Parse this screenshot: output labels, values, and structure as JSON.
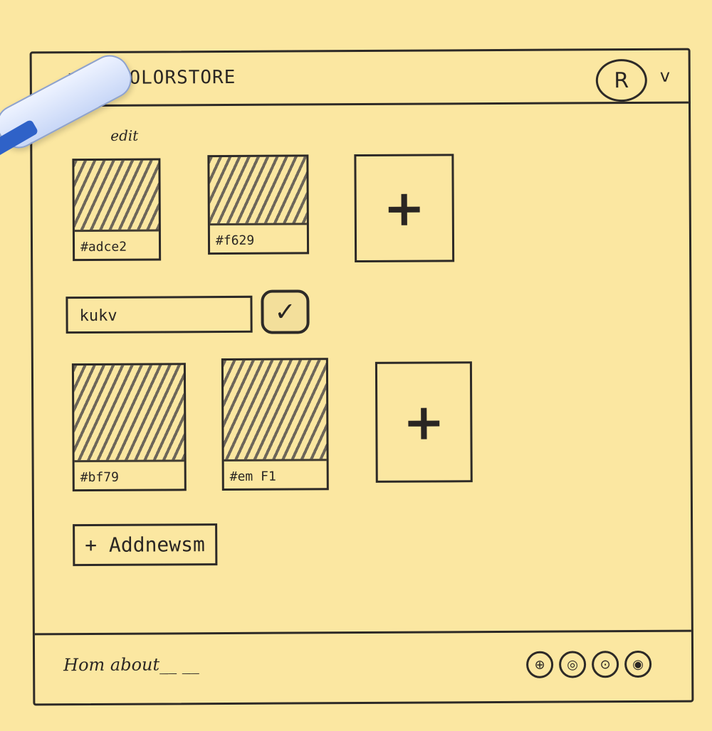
{
  "app": {
    "title": "COLORSTORE"
  },
  "header": {
    "avatar_letter": "R",
    "caret": "v"
  },
  "section": {
    "label": "edit"
  },
  "group1": [
    {
      "code": "#adce2"
    },
    {
      "code": "#f629"
    }
  ],
  "group_name": {
    "value": "kukv"
  },
  "group2": [
    {
      "code": "#bf79"
    },
    {
      "code": "#em  F1"
    }
  ],
  "add_button": {
    "label": "+ Addnewsm"
  },
  "footer": {
    "text": "Hom about__ __"
  },
  "social_icons": [
    "social-icon-1",
    "social-icon-2",
    "social-icon-3",
    "social-icon-4"
  ],
  "colors": {
    "paper": "#fbe7a1",
    "ink": "#2d2a27",
    "marker": "#2f62c8"
  }
}
